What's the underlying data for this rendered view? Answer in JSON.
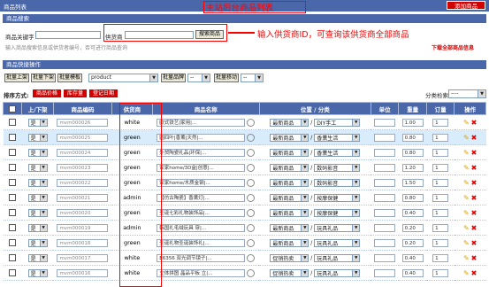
{
  "topbar": {
    "tab_label": "商品列表",
    "add_button": "添加商品"
  },
  "annotations": {
    "title": "主站后台商品列表",
    "supplier_note": "输入供货商ID，可查询该供货商全部商品"
  },
  "search": {
    "section_title": "商品搜索",
    "keyword_label": "商品关键字",
    "keyword_value": "",
    "supplier_label": "供货商",
    "supplier_value": "",
    "submit_label": "搜索商品",
    "hint": "输入商品搜索信息或供货者编号，否可进行商品查询",
    "download_link": "下载全部商品信息"
  },
  "quick_ops": {
    "section_title": "商品快捷操作",
    "buttons": [
      "批量上架",
      "批量下架",
      "批量模板"
    ],
    "template_select": "product",
    "button4": "批量品牌",
    "select4": "--",
    "button5": "批量移动",
    "select5": "--"
  },
  "sort": {
    "label": "排序方式:",
    "buttons": [
      "商品价格",
      "库存量",
      "登记日期"
    ],
    "category_label": "分类检索",
    "category_value": "----"
  },
  "table": {
    "headers": [
      "",
      "上/下架",
      "商品编码",
      "供货商",
      "商品名称",
      "位置 / 分类",
      "单位",
      "重量",
      "订量",
      "操作"
    ],
    "rows": [
      {
        "status": "是",
        "code": "mvm000026",
        "supplier": "white",
        "name": "欧式铁艺|家用|...",
        "position": "最新商品",
        "category": "DIY手工",
        "weight": "1.00",
        "order": "1"
      },
      {
        "status": "是",
        "code": "mvm000025",
        "supplier": "green",
        "name": "圆四叶|香薰|天然|...",
        "position": "最新商品",
        "category": "香薰生活",
        "weight": "0.80",
        "order": "1"
      },
      {
        "status": "是",
        "code": "mvm000024",
        "supplier": "green",
        "name": "外贸陶瓷礼品|环保|...",
        "position": "最新商品",
        "category": "香薰生活",
        "weight": "0.80",
        "order": "1"
      },
      {
        "status": "是",
        "code": "mvm000023",
        "supplier": "green",
        "name": "家家home/3D盒|创意|...",
        "position": "最新商品",
        "category": "数码影音",
        "weight": "1.20",
        "order": "1"
      },
      {
        "status": "是",
        "code": "mvm000022",
        "supplier": "green",
        "name": "家家home/木质金钢|...",
        "position": "最新商品",
        "category": "数码影音",
        "weight": "1.50",
        "order": "1"
      },
      {
        "status": "是",
        "code": "mvm000021",
        "supplier": "admin",
        "name": "【仿古陶瓷】香薰灯|...",
        "position": "最新商品",
        "category": "按摩保健",
        "weight": "0.80",
        "order": "1"
      },
      {
        "status": "是",
        "code": "mvm000020",
        "supplier": "green",
        "name": "圣诞七彩礼物装饰品|...",
        "position": "最新商品",
        "category": "按摩保健",
        "weight": "0.40",
        "order": "1"
      },
      {
        "status": "是",
        "code": "mvm000019",
        "supplier": "admin",
        "name": "韩国礼毛绒玩具 穿|...",
        "position": "最新商品",
        "category": "玩具礼品",
        "weight": "0.20",
        "order": "1"
      },
      {
        "status": "是",
        "code": "mvm000018",
        "supplier": "green",
        "name": "圣诞礼物圣诞装饰礼|...",
        "position": "最新商品",
        "category": "玩具礼品",
        "weight": "0.20",
        "order": "1"
      },
      {
        "status": "是",
        "code": "mvm000017",
        "supplier": "white",
        "name": "E6356 双光调节镜子|...",
        "position": "促销热卖",
        "category": "玩具礼品",
        "weight": "0.40",
        "order": "1"
      },
      {
        "status": "是",
        "code": "mvm000016",
        "supplier": "white",
        "name": "立体拼图 晶品平板 立|...",
        "position": "促销热卖",
        "category": "玩具礼品",
        "weight": "0.40",
        "order": "1"
      }
    ]
  },
  "colors": {
    "header_blue": "#4a67a9",
    "accent_red": "#d30000",
    "annotation_red": "#ff0000",
    "highlight_row": "#d8ecfb"
  },
  "icons": [
    "magnifier-icon",
    "pencil-icon",
    "delete-x-icon",
    "chevron-down-icon"
  ]
}
